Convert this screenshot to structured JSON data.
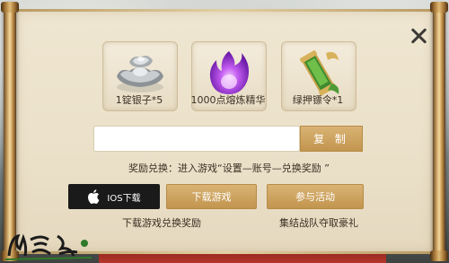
{
  "dialog": {
    "rewards": [
      {
        "label": "1锭银子*5",
        "icon": "silver-ingot-icon"
      },
      {
        "label": "1000点熔炼精华",
        "icon": "purple-flame-icon"
      },
      {
        "label": "绿押镖令*1",
        "icon": "escort-token-icon"
      }
    ],
    "code_input": {
      "value": "",
      "placeholder": ""
    },
    "copy_label": "复 制",
    "hint": "奖励兑换：进入游戏“设置—账号—兑换奖励 ”",
    "ios_label": "IOS下载",
    "download_label": "下载游戏",
    "join_label": "参与活动",
    "download_sub": "下载游戏兑换奖励",
    "join_sub": "集结战队夺取豪礼"
  },
  "colors": {
    "accent_gold": "#c9a063",
    "panel": "#ece2cb",
    "ios_button": "#1a1a1a"
  }
}
